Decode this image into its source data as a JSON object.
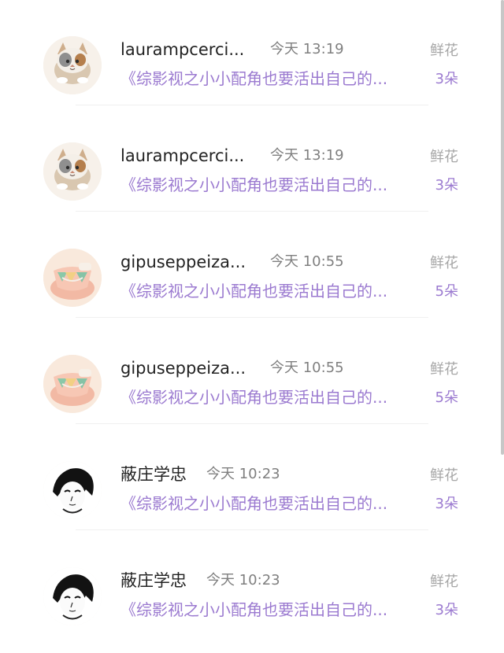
{
  "items": [
    {
      "username": "laurampcerci...",
      "time": "今天 13:19",
      "gift_type": "鲜花",
      "book_title": "《综影视之小小配角也要活出自己的...",
      "gift_count": "3朵",
      "avatar_icon": "cat-avatar-icon"
    },
    {
      "username": "laurampcerci...",
      "time": "今天 13:19",
      "gift_type": "鲜花",
      "book_title": "《综影视之小小配角也要活出自己的...",
      "gift_count": "3朵",
      "avatar_icon": "cat-avatar-icon"
    },
    {
      "username": "gipuseppeiza...",
      "time": "今天 10:55",
      "gift_type": "鲜花",
      "book_title": "《综影视之小小配角也要活出自己的...",
      "gift_count": "5朵",
      "avatar_icon": "cup-avatar-icon"
    },
    {
      "username": "gipuseppeiza...",
      "time": "今天 10:55",
      "gift_type": "鲜花",
      "book_title": "《综影视之小小配角也要活出自己的...",
      "gift_count": "5朵",
      "avatar_icon": "cup-avatar-icon"
    },
    {
      "username": "蔽庄学忠",
      "time": "今天 10:23",
      "gift_type": "鲜花",
      "book_title": "《综影视之小小配角也要活出自己的...",
      "gift_count": "3朵",
      "avatar_icon": "anime-boy-avatar-icon"
    },
    {
      "username": "蔽庄学忠",
      "time": "今天 10:23",
      "gift_type": "鲜花",
      "book_title": "《综影视之小小配角也要活出自己的...",
      "gift_count": "3朵",
      "avatar_icon": "anime-boy-avatar-icon"
    }
  ],
  "colors": {
    "accent": "#9b7ad0",
    "text": "#222222",
    "muted": "#7f7f7f",
    "gift_type": "#a6a6a6",
    "divider": "#f0f0f0"
  }
}
